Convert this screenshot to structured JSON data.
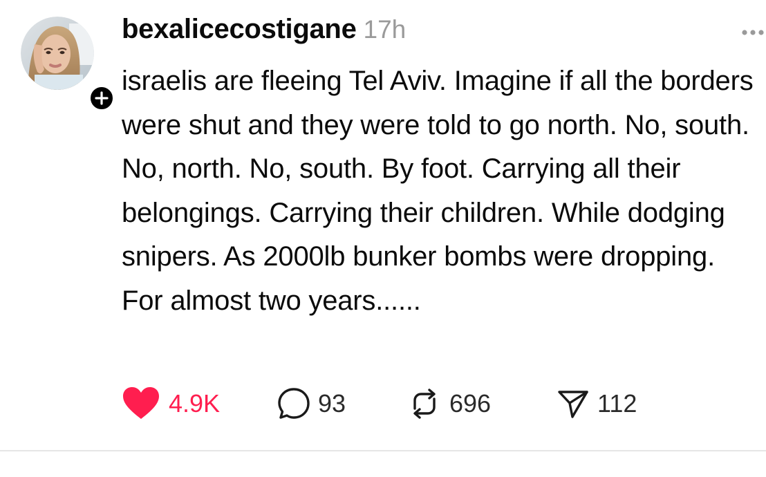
{
  "post": {
    "username": "bexalicecostigane",
    "time": "17h",
    "text": "israelis are fleeing Tel Aviv. Imagine if all the borders were shut and they were told to go north. No, south. No, north. No, south. By foot. Carrying all their belongings. Carrying their children. While dodging snipers. As 2000lb bunker bombs were dropping. For almost two years......",
    "avatar_icon": "avatar-photo",
    "follow_icon": "plus-icon",
    "more_icon": "more-dots-icon"
  },
  "actions": {
    "likes": "4.9K",
    "comments": "93",
    "reposts": "696",
    "shares": "112",
    "like_icon": "heart-filled-icon",
    "comment_icon": "comment-bubble-icon",
    "repost_icon": "repost-icon",
    "share_icon": "send-icon"
  },
  "colors": {
    "like_red": "#ff1e4f",
    "muted_gray": "#9a9a9a",
    "text": "#0b0b0b"
  }
}
